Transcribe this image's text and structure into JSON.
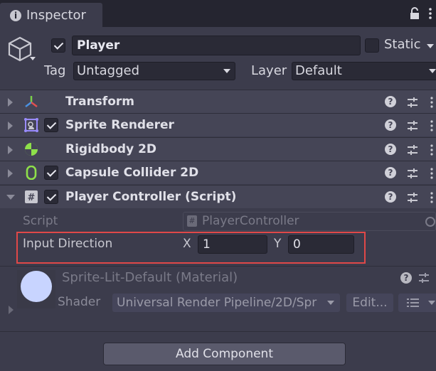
{
  "window": {
    "tab_title": "Inspector"
  },
  "gameobject": {
    "active": true,
    "name": "Player",
    "static_label": "Static",
    "static_checked": false,
    "tag_label": "Tag",
    "tag_value": "Untagged",
    "layer_label": "Layer",
    "layer_value": "Default"
  },
  "components": [
    {
      "title": "Transform",
      "icon": "transform-icon",
      "has_checkbox": false,
      "expanded": false
    },
    {
      "title": "Sprite Renderer",
      "icon": "sprite-renderer-icon",
      "has_checkbox": true,
      "checked": true,
      "expanded": false
    },
    {
      "title": "Rigidbody 2D",
      "icon": "rigidbody-2d-icon",
      "has_checkbox": false,
      "expanded": false
    },
    {
      "title": "Capsule Collider 2D",
      "icon": "capsule-collider-icon",
      "has_checkbox": true,
      "checked": true,
      "expanded": false
    },
    {
      "title": "Player Controller (Script)",
      "icon": "script-icon",
      "has_checkbox": true,
      "checked": true,
      "expanded": true
    }
  ],
  "script": {
    "script_label": "Script",
    "script_value": "PlayerController",
    "input_direction_label": "Input Direction",
    "x_label": "X",
    "x_value": "1",
    "y_label": "Y",
    "y_value": "0"
  },
  "material": {
    "title": "Sprite-Lit-Default (Material)",
    "shader_label": "Shader",
    "shader_value": "Universal Render Pipeline/2D/Spr",
    "edit_label": "Edit..."
  },
  "add_component_label": "Add Component",
  "colors": {
    "highlight": "#e04848",
    "rigidbody_green": "#8ee04a",
    "collider_green": "#8ee04a",
    "sprite_purple": "#9a8cff",
    "material_sphere": "#c8d4ff"
  }
}
